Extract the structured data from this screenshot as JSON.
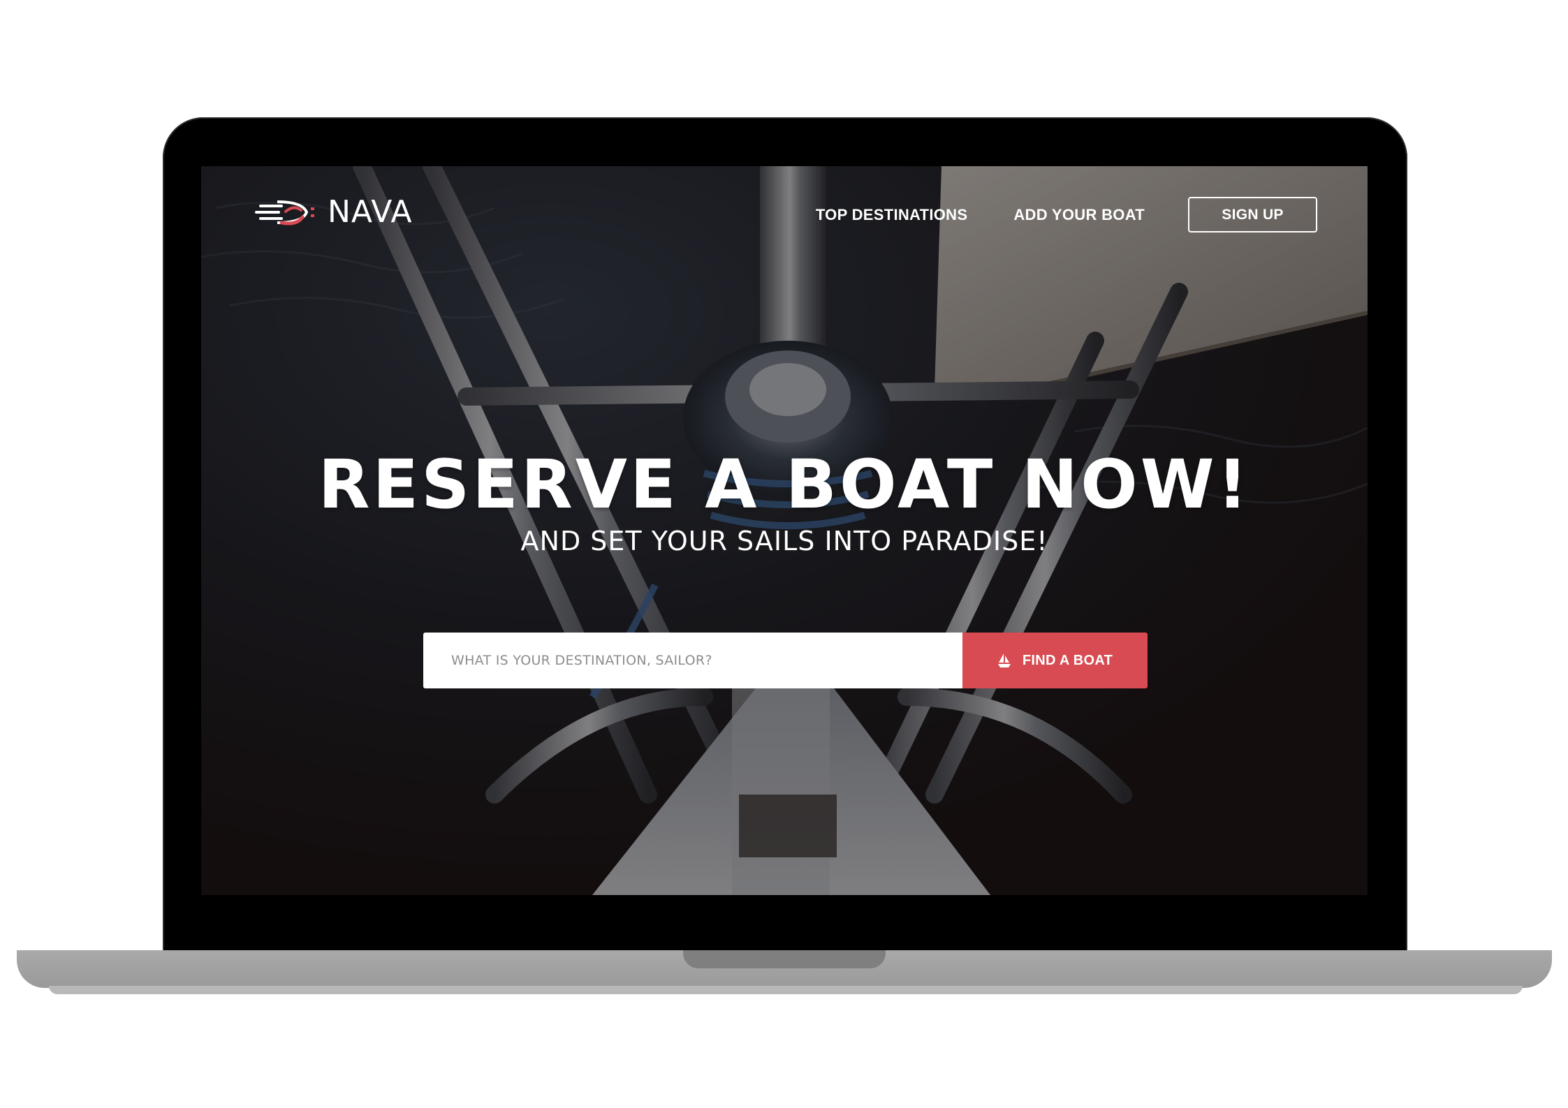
{
  "brand": {
    "name": "NAVA",
    "accent_color": "#d84b52"
  },
  "nav": {
    "links": [
      "TOP DESTINATIONS",
      "ADD YOUR BOAT"
    ],
    "signup_label": "SIGN UP"
  },
  "hero": {
    "headline": "RESERVE A BOAT NOW!",
    "subheadline": "AND SET YOUR SAILS INTO PARADISE!",
    "background": "sailboat bow photo (dark overlay)"
  },
  "search": {
    "placeholder": "WHAT IS YOUR DESTINATION, SAILOR?",
    "value": "",
    "button_label": "FIND A BOAT",
    "button_icon": "sailboat-icon"
  }
}
